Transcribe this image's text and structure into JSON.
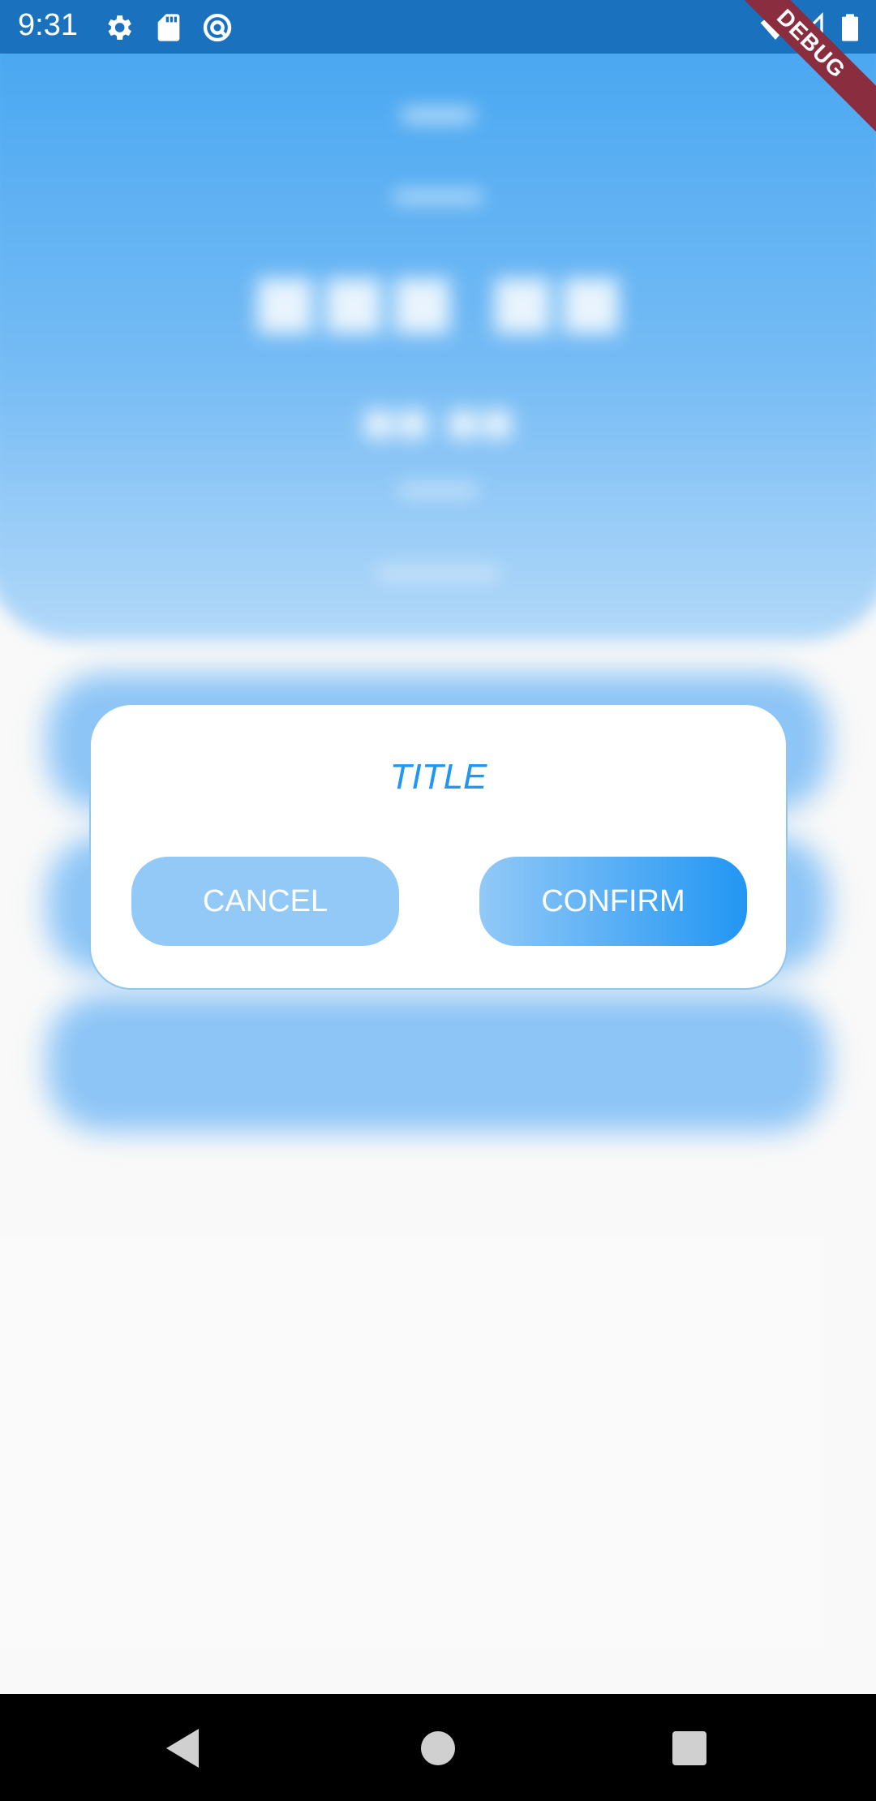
{
  "status_bar": {
    "time": "9:31",
    "left_icons": [
      "gear-icon",
      "sd-card-icon",
      "sync-icon"
    ],
    "right_icons": [
      "wifi-icon",
      "signal-icon",
      "battery-icon"
    ],
    "debug_label": "DEBUG",
    "color": "#1a72be"
  },
  "dialog": {
    "title": "TITLE",
    "cancel_label": "CANCEL",
    "confirm_label": "CONFIRM",
    "accent_color": "#2196f3"
  },
  "navigation": {
    "icons": [
      "back-icon",
      "home-icon",
      "recent-apps-icon"
    ]
  }
}
